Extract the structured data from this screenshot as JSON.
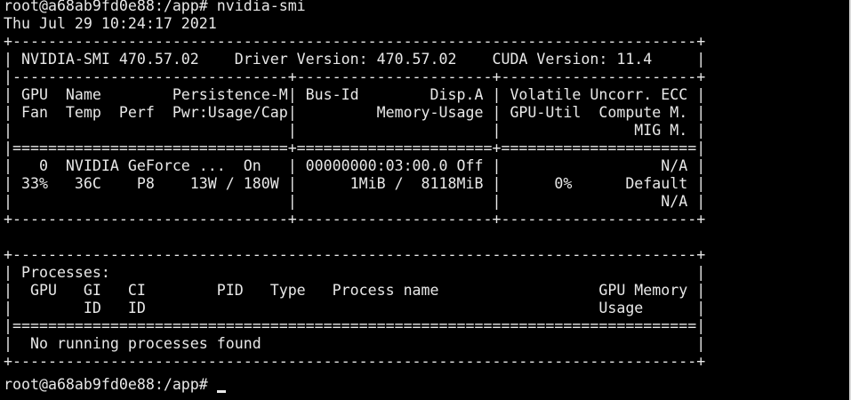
{
  "terminal": {
    "lines": [
      "root@a68ab9fd0e88:/app# nvidia-smi",
      "Thu Jul 29 10:24:17 2021",
      "+-----------------------------------------------------------------------------+",
      "| NVIDIA-SMI 470.57.02    Driver Version: 470.57.02    CUDA Version: 11.4     |",
      "|-------------------------------+----------------------+----------------------+",
      "| GPU  Name        Persistence-M| Bus-Id        Disp.A | Volatile Uncorr. ECC |",
      "| Fan  Temp  Perf  Pwr:Usage/Cap|         Memory-Usage | GPU-Util  Compute M. |",
      "|                               |                      |               MIG M. |",
      "|===============================+======================+======================|",
      "|   0  NVIDIA GeForce ...  On   | 00000000:03:00.0 Off |                  N/A |",
      "| 33%   36C    P8    13W / 180W |      1MiB /  8118MiB |      0%      Default |",
      "|                               |                      |                  N/A |",
      "+-------------------------------+----------------------+----------------------+",
      "",
      "+-----------------------------------------------------------------------------+",
      "| Processes:                                                                  |",
      "|  GPU   GI   CI        PID   Type   Process name                  GPU Memory |",
      "|        ID   ID                                                   Usage      |",
      "|=============================================================================|",
      "|  No running processes found                                                 |",
      "+-----------------------------------------------------------------------------+",
      "root@a68ab9fd0e88:/app# "
    ]
  }
}
